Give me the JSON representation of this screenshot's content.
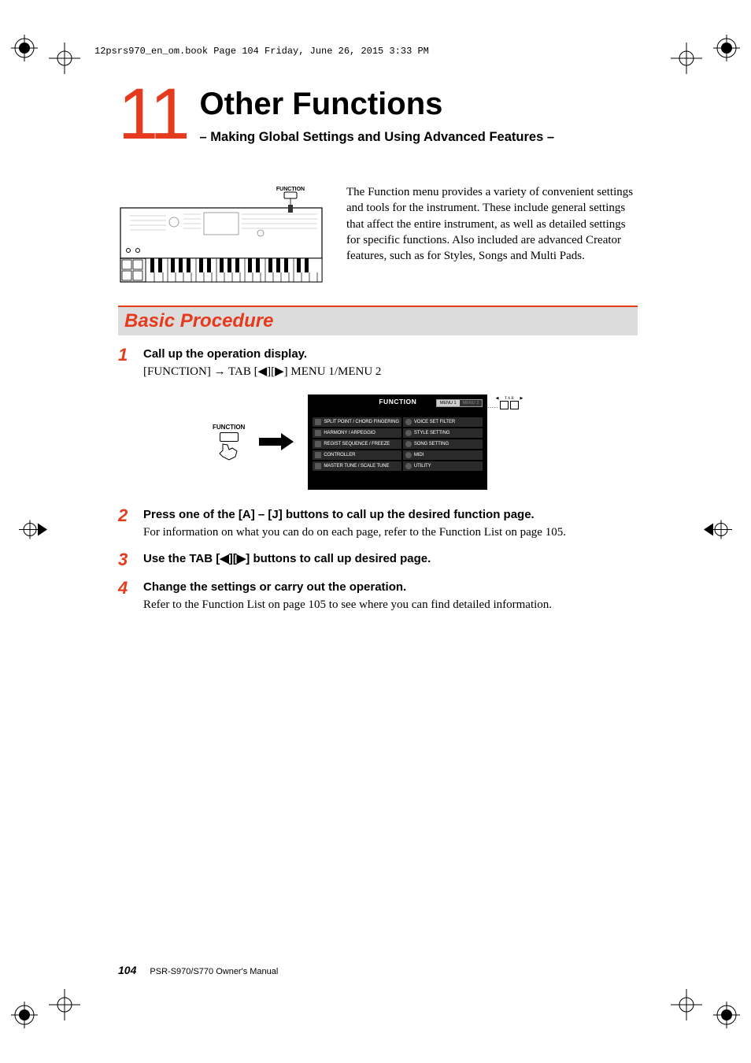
{
  "running_header": "12psrs970_en_om.book  Page 104  Friday, June 26, 2015  3:33 PM",
  "chapter_number": "11",
  "chapter_title": "Other Functions",
  "chapter_subtitle": "– Making Global Settings and Using Advanced Features –",
  "intro_text": "The Function menu provides a variety of convenient settings and tools for the instrument. These include general settings that affect the entire instrument, as well as detailed settings for specific functions. Also included are advanced Creator features, such as for Styles, Songs and Multi Pads.",
  "keyboard_label_function": "FUNCTION",
  "section_title": "Basic Procedure",
  "steps": [
    {
      "num": "1",
      "title": "Call up the operation display.",
      "body": "[FUNCTION] → TAB [◀][▶] MENU 1/MENU 2"
    },
    {
      "num": "2",
      "title": "Press one of the [A] – [J] buttons to call up the desired function page.",
      "body": "For information on what you can do on each page, refer to the Function List on page 105."
    },
    {
      "num": "3",
      "title": "Use the TAB [◀][▶] buttons to call up desired page.",
      "body": ""
    },
    {
      "num": "4",
      "title": "Change the settings or carry out the operation.",
      "body": "Refer to the Function List on page 105 to see where you can find detailed information."
    }
  ],
  "diagram": {
    "button_label": "FUNCTION",
    "screen_title": "FUNCTION",
    "tabs": {
      "active": "MENU 1",
      "inactive": "MENU 2"
    },
    "tab_arrows_label": "TAB",
    "left_items": [
      "SPLIT POINT / CHORD FINGERING",
      "HARMONY / ARPEGGIO",
      "REGIST SEQUENCE / FREEZE",
      "CONTROLLER",
      "MASTER TUNE / SCALE TUNE"
    ],
    "right_items": [
      "VOICE SET FILTER",
      "STYLE SETTING",
      "SONG SETTING",
      "MIDI",
      "UTILITY"
    ]
  },
  "footer": {
    "page_number": "104",
    "doc_title": "PSR-S970/S770 Owner's Manual"
  }
}
